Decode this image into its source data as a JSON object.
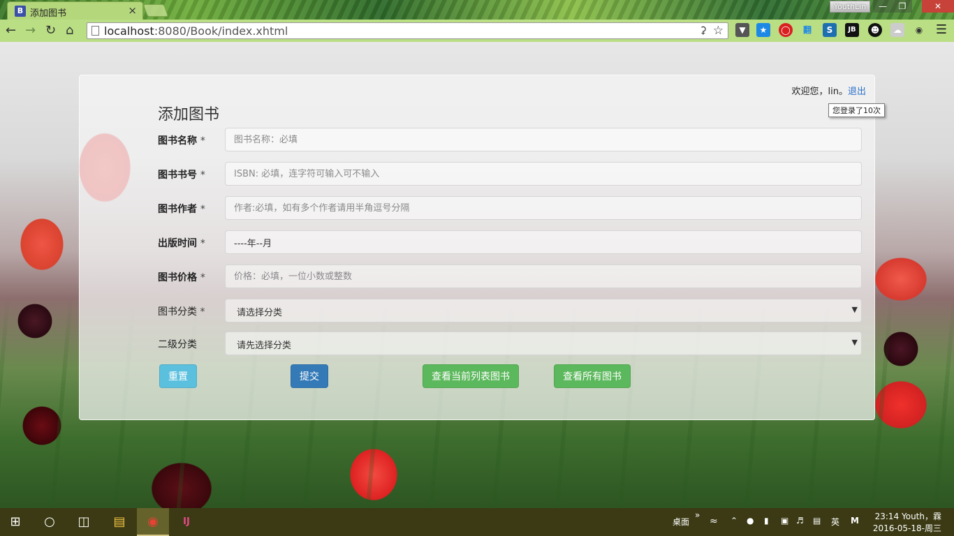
{
  "browser": {
    "tab_title": "添加图书",
    "tab_favicon": "B",
    "tab_close": "×",
    "user_chip": "YouthLin",
    "url_host": "localhost",
    "url_path": ":8080/Book/index.xhtml",
    "window_buttons": {
      "minimize": "—",
      "restore": "❐",
      "close": "✕"
    },
    "extensions": [
      "pocket-icon",
      "bookmark-star-icon",
      "adblock-icon",
      "翻",
      "s-icon",
      "JB",
      "avatar-icon",
      "cloud-icon",
      "puzzle-icon"
    ]
  },
  "header": {
    "welcome_text": "欢迎您，lin。",
    "logout_label": "退出",
    "login_tooltip": "您登录了10次"
  },
  "form": {
    "title": "添加图书",
    "required_mark": "*",
    "fields": [
      {
        "label": "图书名称",
        "placeholder": "图书名称：必填",
        "required": true
      },
      {
        "label": "图书书号",
        "placeholder": "ISBN: 必填，连字符可输入可不输入",
        "required": true
      },
      {
        "label": "图书作者",
        "placeholder": "作者:必填，如有多个作者请用半角逗号分隔",
        "required": true
      },
      {
        "label": "出版时间",
        "value": "----年--月",
        "required": true
      },
      {
        "label": "图书价格",
        "placeholder": "价格：必填，一位小数或整数",
        "required": true
      }
    ],
    "category": {
      "label": "图书分类",
      "selected": "请选择分类",
      "required": true
    },
    "subcategory": {
      "label": "二级分类",
      "selected": "请先选择分类",
      "required": false
    },
    "buttons": {
      "reset": "重置",
      "submit": "提交",
      "view_current": "查看当前列表图书",
      "view_all": "查看所有图书"
    }
  },
  "taskbar": {
    "desktop_label": "桌面",
    "ime_label": "英",
    "ime2_label": "M",
    "clock_time": "23:14 Youth，霖",
    "clock_date": "2016-05-18-周三"
  }
}
